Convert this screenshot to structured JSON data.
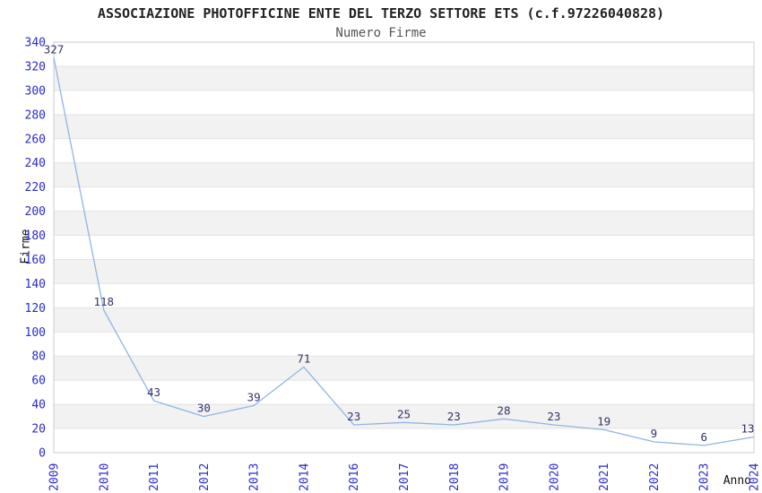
{
  "header": {
    "title": "ASSOCIAZIONE PHOTOFFICINE ENTE DEL TERZO SETTORE ETS (c.f.97226040828)",
    "subtitle": "Numero Firme"
  },
  "chart_data": {
    "type": "line",
    "title": "ASSOCIAZIONE PHOTOFFICINE ENTE DEL TERZO SETTORE ETS (c.f.97226040828)",
    "subtitle": "Numero Firme",
    "xlabel": "Anno",
    "ylabel": "Firme",
    "x": [
      "2009",
      "2010",
      "2011",
      "2012",
      "2013",
      "2014",
      "2016",
      "2017",
      "2018",
      "2019",
      "2020",
      "2021",
      "2022",
      "2023",
      "2024"
    ],
    "series": [
      {
        "name": "Numero Firme",
        "values": [
          327,
          118,
          43,
          30,
          39,
          71,
          23,
          25,
          23,
          28,
          23,
          19,
          9,
          6,
          13
        ]
      }
    ],
    "data_labels_visible": true,
    "ylim": [
      0,
      340
    ],
    "ytick_step": 20,
    "grid": "horizontal, alternating shaded bands",
    "legend_position": "none",
    "colors": {
      "line": "#90b5e2",
      "tick_label": "#2a2ace",
      "data_label": "#333369",
      "band_shaded": "#f2f2f2",
      "band_plain": "#ffffff",
      "gridline": "#e3e3e3",
      "plot_border": "#cccccc",
      "title_text": "#222222",
      "subtitle_text": "#555555",
      "axis_title_text": "#111111",
      "background": "#ffffff"
    }
  }
}
